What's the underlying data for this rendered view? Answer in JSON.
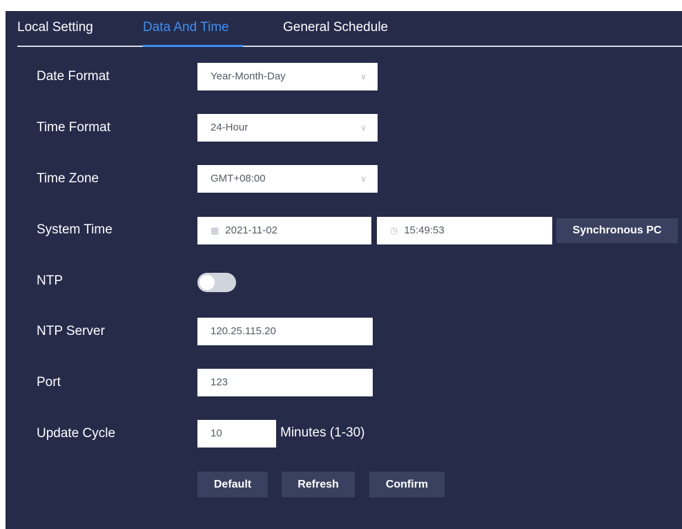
{
  "tabs": [
    {
      "label": "Local Setting"
    },
    {
      "label": "Data And Time"
    },
    {
      "label": "General Schedule"
    }
  ],
  "active_tab": "Data And Time",
  "colors": {
    "background": "#262b4a",
    "accent": "#3d8ff2",
    "button": "#3a4160"
  },
  "form": {
    "date_format": {
      "label": "Date Format",
      "value": "Year-Month-Day"
    },
    "time_format": {
      "label": "Time Format",
      "value": "24-Hour"
    },
    "time_zone": {
      "label": "Time Zone",
      "value": "GMT+08:00"
    },
    "system_time": {
      "label": "System Time",
      "date": "2021-11-02",
      "time": "15:49:53",
      "sync_button": "Synchronous PC"
    },
    "ntp": {
      "label": "NTP",
      "enabled": false
    },
    "ntp_server": {
      "label": "NTP Server",
      "value": "120.25.115.20"
    },
    "port": {
      "label": "Port",
      "value": "123"
    },
    "update_cycle": {
      "label": "Update Cycle",
      "value": "10",
      "unit": "Minutes (1-30)"
    }
  },
  "buttons": {
    "default": "Default",
    "refresh": "Refresh",
    "confirm": "Confirm"
  },
  "icons": {
    "select_chevron": "chevron-down-icon",
    "date_picker": "calendar-icon",
    "time_picker": "clock-icon"
  }
}
